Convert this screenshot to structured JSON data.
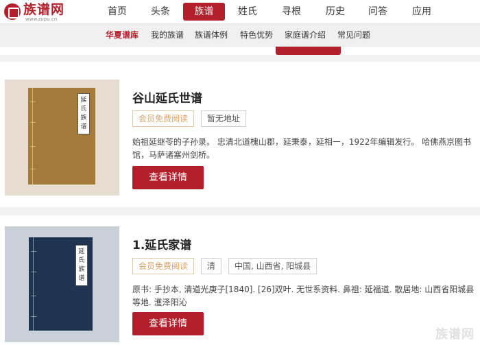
{
  "site": {
    "logo_text": "族谱网",
    "logo_sub": "www.zupu.cn",
    "watermark": "族谱网"
  },
  "main_nav": [
    {
      "label": "首页"
    },
    {
      "label": "头条"
    },
    {
      "label": "族谱",
      "active": true
    },
    {
      "label": "姓氏"
    },
    {
      "label": "寻根"
    },
    {
      "label": "历史"
    },
    {
      "label": "问答"
    },
    {
      "label": "应用"
    }
  ],
  "sub_nav": [
    {
      "label": "华夏谱库",
      "active": true
    },
    {
      "label": "我的族谱"
    },
    {
      "label": "族谱体例"
    },
    {
      "label": "特色优势"
    },
    {
      "label": "家庭谱介绍"
    },
    {
      "label": "常见问题"
    }
  ],
  "results": [
    {
      "title": "谷山延氏世谱",
      "cover_label": [
        "延",
        "氏",
        "族",
        "谱"
      ],
      "tags": [
        "会员免费阅读",
        "暂无地址"
      ],
      "description": "始祖延继苓的子孙录。 忠清北道槐山郡，延秉泰，延相一，1922年编辑发行。 哈佛燕京图书馆，马萨诸塞州剑桥。",
      "button": "查看详情",
      "colors": {
        "cover_bg": "#a47b3a",
        "cover_frame": "#e6dcd0"
      }
    },
    {
      "title": "1.延氏家谱",
      "cover_label": [
        "延",
        "氏",
        "族",
        "谱"
      ],
      "tags": [
        "会员免费阅读",
        "清",
        "中国, 山西省, 阳城县"
      ],
      "description": "原书: 手抄本, 清道光庚子[1840]. [26]双叶. 无世系资料. 鼻祖: 延福道. 散居地: 山西省阳城县等地. 濩泽阳沁",
      "button": "查看详情",
      "colors": {
        "cover_bg": "#1f3450",
        "cover_frame": "#c9d0d8"
      }
    }
  ],
  "colors": {
    "brand": "#b3202c",
    "member_tag": "#d9a36b"
  }
}
